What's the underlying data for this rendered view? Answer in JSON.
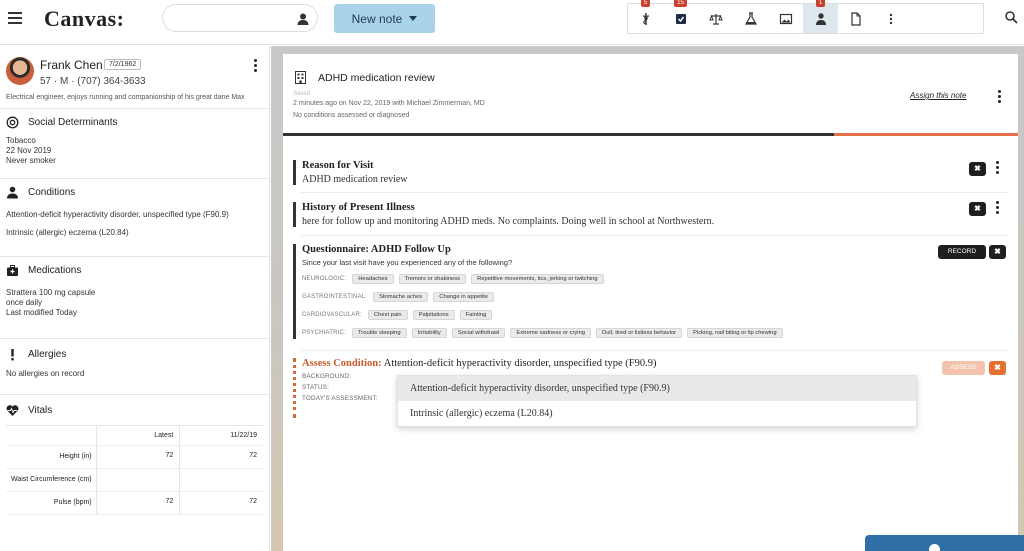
{
  "app": {
    "logo": "Canvas:"
  },
  "header": {
    "search": {
      "placeholder": ""
    },
    "new_note_label": "New note",
    "toolbar": [
      {
        "name": "caduceus-icon",
        "badge": "5"
      },
      {
        "name": "checkbox-icon",
        "badge": "15"
      },
      {
        "name": "scale-icon",
        "badge": ""
      },
      {
        "name": "flask-icon",
        "badge": ""
      },
      {
        "name": "image-icon",
        "badge": ""
      },
      {
        "name": "doctor-icon",
        "badge": "1",
        "active": true
      },
      {
        "name": "document-icon",
        "badge": ""
      },
      {
        "name": "more-vertical-icon",
        "badge": ""
      }
    ]
  },
  "patient": {
    "name": "Frank Chen",
    "dob": "7/2/1962",
    "info": "57 · M · (707) 364-3633",
    "description": "Electrical engineer, enjoys running and companionship of his great dane Max"
  },
  "sidebar": {
    "social": {
      "title": "Social Determinants",
      "lines": [
        "Tobacco",
        "22 Nov 2019",
        "Never smoker"
      ]
    },
    "conditions": {
      "title": "Conditions",
      "items": [
        "Attention-deficit hyperactivity disorder, unspecified type (F90.9)",
        "Intrinsic (allergic) eczema (L20.84)"
      ]
    },
    "medications": {
      "title": "Medications",
      "lines": [
        "Strattera 100 mg capsule",
        "once daily",
        "Last modified Today"
      ]
    },
    "allergies": {
      "title": "Allergies",
      "text": "No allergies on record"
    },
    "vitals": {
      "title": "Vitals",
      "columns": [
        "",
        "Latest",
        "11/22/19"
      ],
      "rows": [
        [
          "Height (in)",
          "72",
          "72"
        ],
        [
          "Waist Circumference (cm)",
          "",
          ""
        ],
        [
          "Pulse (bpm)",
          "72",
          "72"
        ]
      ]
    }
  },
  "note": {
    "title": "ADHD medication review",
    "saved": "Saved",
    "meta1": "2 minutes ago on Nov 22, 2019 with Michael Zimmerman, MD",
    "meta2": "No conditions assessed or diagnosed",
    "assign": "Assign this note",
    "progress": 0.75,
    "reason": {
      "title": "Reason for Visit",
      "text": "ADHD medication review"
    },
    "hpi": {
      "title": "History of Present Illness",
      "text": "here for follow up and monitoring ADHD meds.  No complaints.  Doing well in school at Northwestern."
    },
    "questionnaire": {
      "title": "Questionnaire: ADHD Follow Up",
      "subtitle": "Since your last visit have you experienced any of the following?",
      "record_label": "RECORD",
      "rows": [
        {
          "label": "NEUROLOGIC:",
          "tags": [
            "Headaches",
            "Tremors or shakiness",
            "Repetitive movements, tics, jerking or twitching"
          ]
        },
        {
          "label": "GASTROINTESTINAL:",
          "tags": [
            "Stomache aches",
            "Change in appetite"
          ]
        },
        {
          "label": "CARDIOVASCULAR:",
          "tags": [
            "Chest pain",
            "Palpitations",
            "Fainting"
          ]
        },
        {
          "label": "PSYCHIATRIC:",
          "tags": [
            "Trouble sleeping",
            "Irritability",
            "Social withdrawl",
            "Extreme sadness or crying",
            "Dull, tired or listless behavior",
            "Picking, nail biting or lip chewing"
          ]
        }
      ]
    },
    "assess": {
      "label": "Assess Condition:",
      "value": "Attention-deficit hyperactivity disorder, unspecified type  (F90.9)",
      "fields": [
        "BACKGROUND:",
        "STATUS:",
        "TODAY'S ASSESSMENT:"
      ],
      "button": "ASSESS",
      "options": [
        "Attention-deficit hyperactivity disorder, unspecified type  (F90.9)",
        "Intrinsic (allergic) eczema  (L20.84)"
      ]
    }
  },
  "colors": {
    "accent_orange": "#e4704c",
    "new_note_bg": "#a9d3ea",
    "badge_red": "#c9402f"
  }
}
